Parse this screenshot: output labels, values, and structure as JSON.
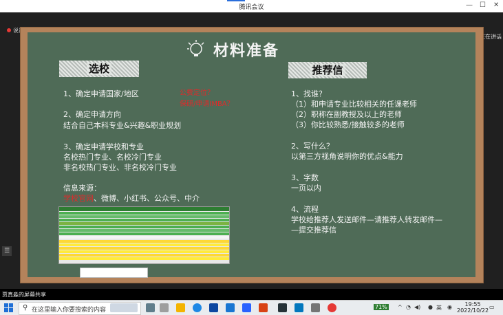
{
  "window": {
    "title": "腾讯会议",
    "minimize": "—",
    "maximize": "☐",
    "close": "✕"
  },
  "meeting": {
    "speaker_label": "说话：",
    "side_label": "正在讲话",
    "menu_icon": "menu-icon"
  },
  "slide": {
    "title": "材料准备",
    "left": {
      "header": "选校",
      "items": [
        "1、确定申请国家/地区",
        "2、确定申请方向",
        "结合自己本科专业&兴趣&职业规划",
        "3、确定申请学校和专业",
        "名校热门专业、名校冷门专业",
        "非名校热门专业、非名校冷门专业",
        "信息来源："
      ],
      "source_highlight": "学校官网",
      "source_rest": "、微博、小红书、公众号、中介",
      "notes": [
        "公费定位？",
        "保研/申请IMBA？"
      ]
    },
    "right": {
      "header": "推荐信",
      "items": [
        "1、找谁？",
        "（1）和申请专业比较相关的任课老师",
        "（2）职称在副教授及以上的老师",
        "（3）你比较熟悉/接触较多的老师",
        "2、写什么？",
        "以第三方视角说明你的优点&能力",
        "3、字数",
        "一页以内",
        "4、流程",
        "学校给推荐人发送邮件—请推荐人转发邮件—",
        "—提交推荐信"
      ]
    }
  },
  "share_bar": {
    "text": "贾真淼的屏幕共享"
  },
  "taskbar": {
    "search_placeholder": "在这里输入你要搜索的内容",
    "battery": "71%",
    "ime": "英",
    "time": "19:55",
    "date": "2022/10/22"
  },
  "colors": {
    "board": "#4f6b57",
    "frame": "#b4835b",
    "chalk_red": "#e02a2a",
    "accent": "#2a6edb"
  }
}
